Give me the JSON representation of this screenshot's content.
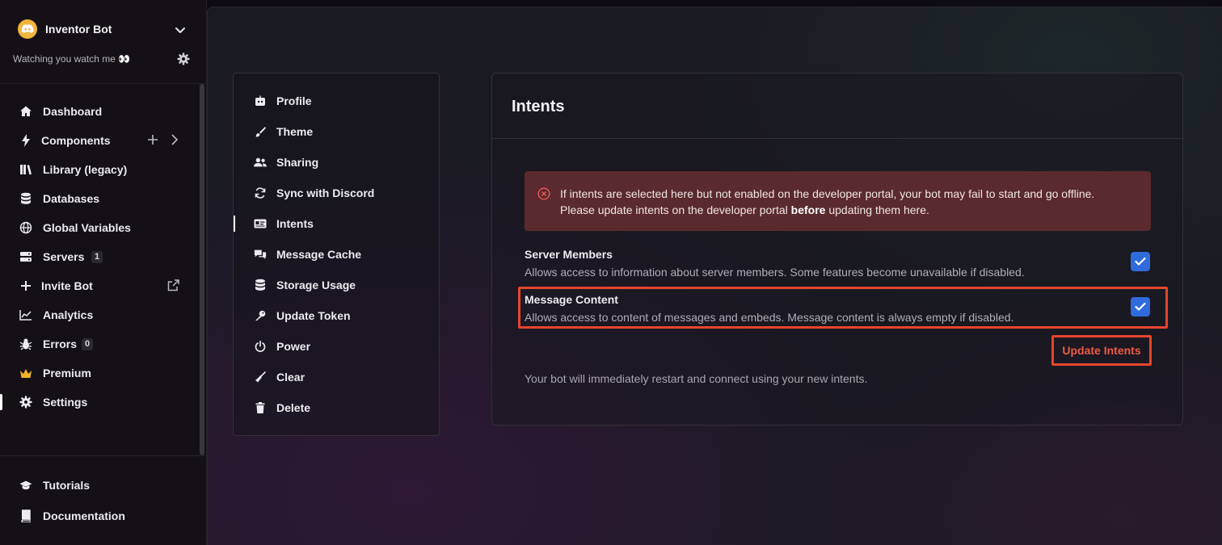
{
  "bot": {
    "name": "Inventor Bot",
    "status": "Watching you watch me 👀"
  },
  "sidebar": {
    "items": [
      {
        "label": "Dashboard",
        "icon": "home-icon"
      },
      {
        "label": "Components",
        "icon": "bolt-icon"
      },
      {
        "label": "Library (legacy)",
        "icon": "library-icon"
      },
      {
        "label": "Databases",
        "icon": "database-icon"
      },
      {
        "label": "Global Variables",
        "icon": "globe-icon"
      },
      {
        "label": "Servers",
        "icon": "server-icon",
        "badge": "1"
      },
      {
        "label": "Invite Bot",
        "icon": "plus-icon"
      },
      {
        "label": "Analytics",
        "icon": "analytics-icon"
      },
      {
        "label": "Errors",
        "icon": "bug-icon",
        "badge": "0"
      },
      {
        "label": "Premium",
        "icon": "crown-icon"
      },
      {
        "label": "Settings",
        "icon": "gear-icon",
        "active": true
      }
    ],
    "bottom": [
      {
        "label": "Tutorials",
        "icon": "graduation-cap-icon"
      },
      {
        "label": "Documentation",
        "icon": "book-icon"
      }
    ]
  },
  "settings_menu": {
    "items": [
      {
        "label": "Profile",
        "icon": "robot-icon"
      },
      {
        "label": "Theme",
        "icon": "brush-icon"
      },
      {
        "label": "Sharing",
        "icon": "users-icon"
      },
      {
        "label": "Sync with Discord",
        "icon": "sync-icon"
      },
      {
        "label": "Intents",
        "icon": "id-card-icon",
        "active": true
      },
      {
        "label": "Message Cache",
        "icon": "comments-icon"
      },
      {
        "label": "Storage Usage",
        "icon": "database-icon"
      },
      {
        "label": "Update Token",
        "icon": "key-icon"
      },
      {
        "label": "Power",
        "icon": "power-icon"
      },
      {
        "label": "Clear",
        "icon": "broom-icon"
      },
      {
        "label": "Delete",
        "icon": "trash-icon"
      }
    ]
  },
  "intents": {
    "title": "Intents",
    "alert_part1": "If intents are selected here but not enabled on the developer portal, your bot may fail to start and go offline. Please update intents on the developer portal ",
    "alert_bold": "before",
    "alert_part2": " updating them here.",
    "options": [
      {
        "title": "Server Members",
        "description": "Allows access to information about server members. Some features become unavailable if disabled.",
        "checked": true
      },
      {
        "title": "Message Content",
        "description": "Allows access to content of messages and embeds. Message content is always empty if disabled.",
        "checked": true
      }
    ],
    "update_button": "Update Intents",
    "note": "Your bot will immediately restart and connect using your new intents."
  },
  "colors": {
    "accent_blue": "#2f6bdc",
    "highlight_red": "#e4462c",
    "alert_bg": "#5a2a2e"
  }
}
